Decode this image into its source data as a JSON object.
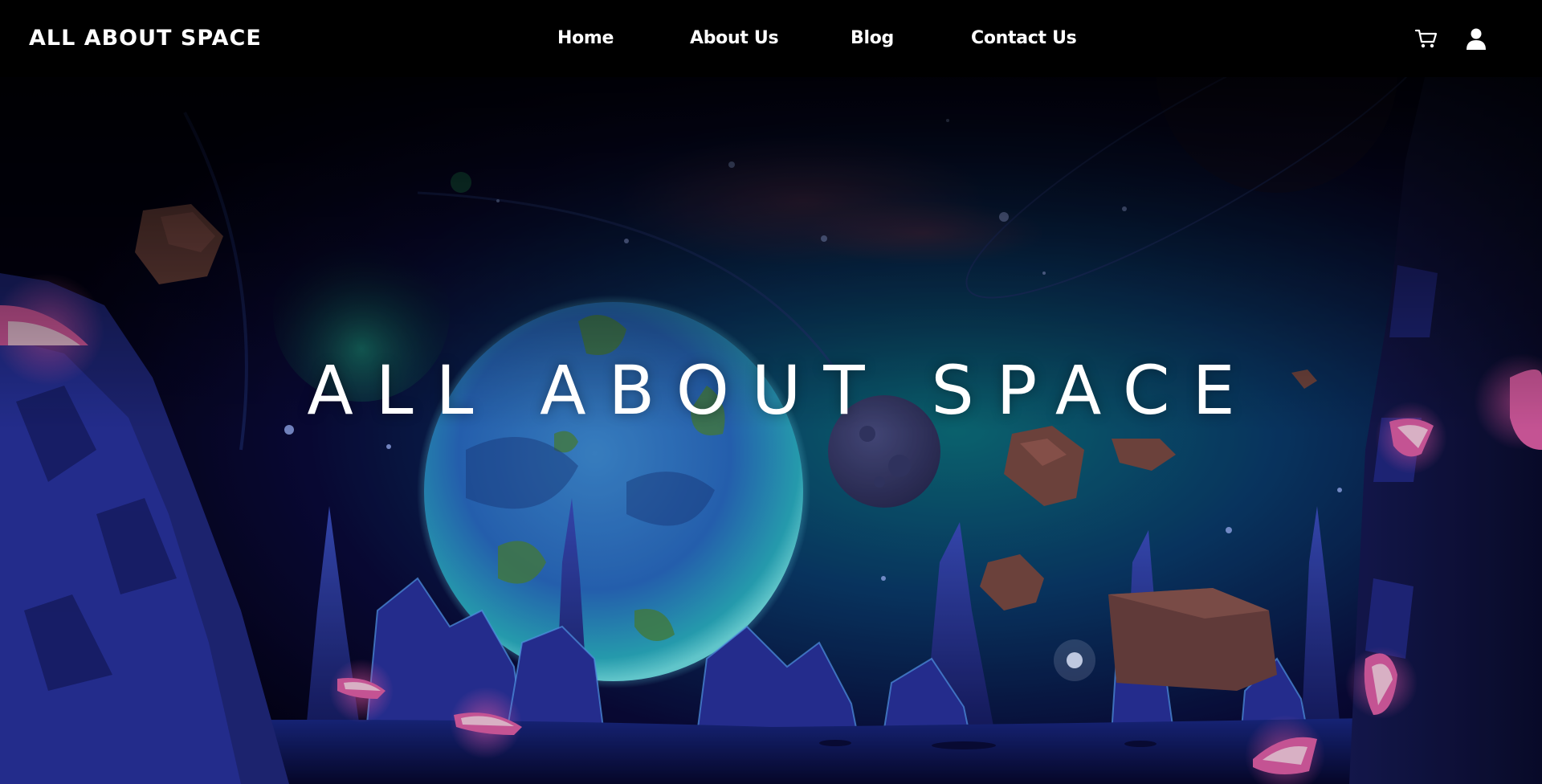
{
  "site": {
    "logo_text": "ALL ABOUT SPACE"
  },
  "nav": {
    "items": [
      {
        "label": "Home"
      },
      {
        "label": "About Us"
      },
      {
        "label": "Blog"
      },
      {
        "label": "Contact Us"
      }
    ]
  },
  "header_icons": {
    "cart": "cart-icon",
    "account": "user-icon"
  },
  "hero": {
    "title": "ALL ABOUT SPACE",
    "background": "space-landscape-illustration"
  },
  "colors": {
    "background": "#000000",
    "text": "#ffffff",
    "sky_deep": "#070626",
    "sky_teal": "#0b6e7c",
    "planet_blue": "#3a8fd6",
    "rock_purple": "#2a2f8f",
    "crystal_pink": "#e86fb3",
    "asteroid_brown": "#7a4a44"
  }
}
